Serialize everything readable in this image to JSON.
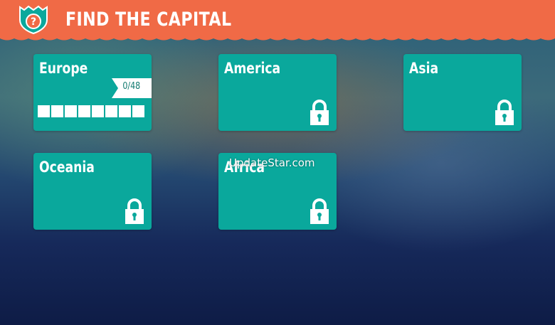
{
  "header": {
    "title": "FIND THE CAPITAL",
    "background_color": "#f06a46",
    "logo_icon": "shield-question-icon"
  },
  "cards": [
    {
      "name": "Europe",
      "progress_text": "0/48",
      "locked": false,
      "progress_squares": 8,
      "progress_fraction": 0
    },
    {
      "name": "America",
      "locked": true
    },
    {
      "name": "Asia",
      "locked": true
    },
    {
      "name": "Oceania",
      "locked": true
    },
    {
      "name": "Africa",
      "locked": true
    }
  ],
  "card_color": "#0aa89c",
  "lock_icon": "padlock-icon",
  "watermark": "UpdateStar.com"
}
